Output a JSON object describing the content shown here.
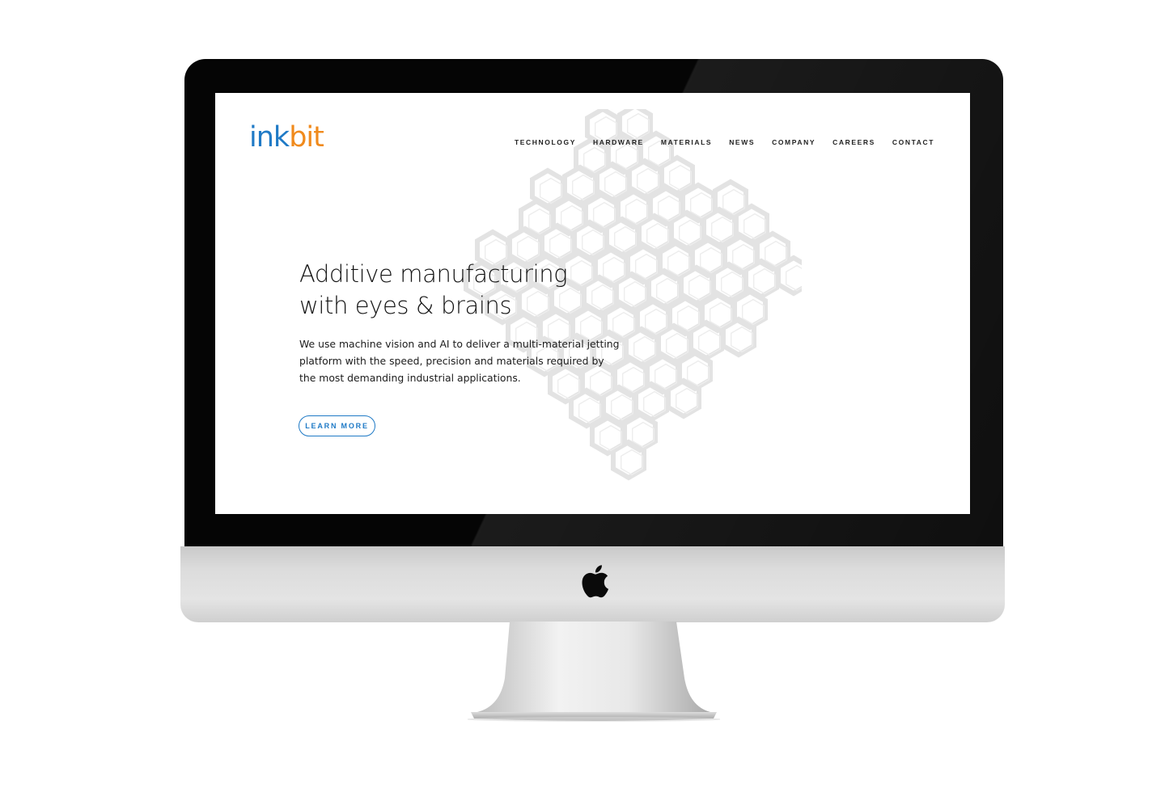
{
  "site": {
    "logo": {
      "part1": "ink",
      "part2": "bit"
    },
    "nav": [
      "TECHNOLOGY",
      "HARDWARE",
      "MATERIALS",
      "NEWS",
      "COMPANY",
      "CAREERS",
      "CONTACT"
    ],
    "hero": {
      "headline_line1": "Additive manufacturing",
      "headline_line2": "with eyes & brains",
      "body_line1": "We use machine vision and AI to deliver a multi-material jetting",
      "body_line2": "platform with the speed, precision and materials required by",
      "body_line3": "the most demanding industrial applications.",
      "cta_label": "LEARN MORE"
    }
  },
  "colors": {
    "brand_blue": "#1f7ac6",
    "brand_orange": "#f08a1c",
    "text": "#141414",
    "bezel": "#050505",
    "chin": "#dcdcdc"
  },
  "icons": {
    "device_logo": "apple-logo-icon",
    "hero_art": "hexagon-lattice-image"
  }
}
